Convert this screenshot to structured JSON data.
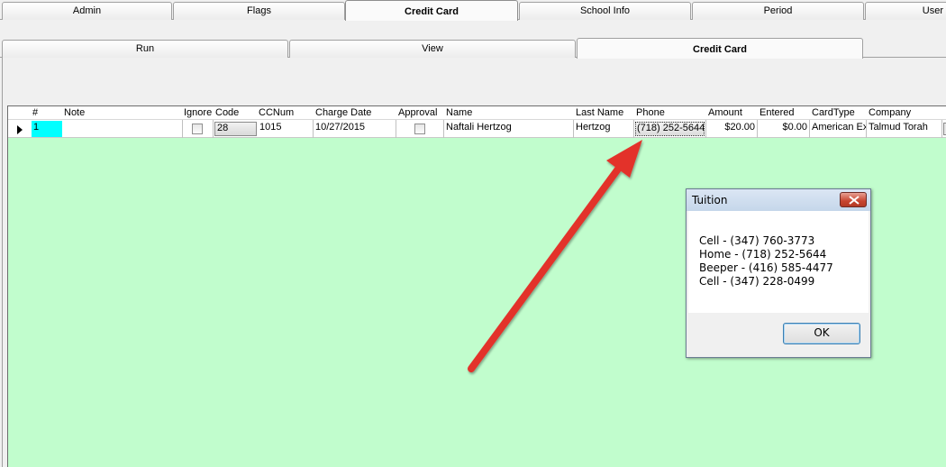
{
  "top_tabs": [
    "Admin",
    "Flags",
    "Credit Card",
    "School Info",
    "Period",
    "User"
  ],
  "top_active": "Credit Card",
  "sub_tabs": [
    "Run",
    "View",
    "Credit Card"
  ],
  "sub_active": "Credit Card",
  "grid": {
    "columns": [
      "#",
      "Note",
      "Ignore",
      "Code",
      "CCNum",
      "Charge Date",
      "Approval",
      "Name",
      "Last Name",
      "Phone",
      "Amount",
      "Entered",
      "CardType",
      "Company"
    ],
    "row": {
      "num": "1",
      "note": "",
      "code": "28",
      "ccnum": "1015",
      "charge_date": "10/27/2015",
      "name": "Naftali Hertzog",
      "last_name": "Hertzog",
      "phone": "(718) 252-5644",
      "amount": "$20.00",
      "entered": "$0.00",
      "card_type": "American Ex",
      "company": "Talmud Torah"
    }
  },
  "dialog": {
    "title": "Tuition",
    "lines": [
      "Cell - (347) 760-3773",
      "Home - (718) 252-5644",
      "Beeper - (416) 585-4477",
      "Cell - (347) 228-0499"
    ],
    "ok_label": "OK"
  },
  "colors": {
    "grid_background": "#c1fdcd",
    "selected_cell": "#00ffff",
    "annotation_arrow": "#e3302b"
  }
}
